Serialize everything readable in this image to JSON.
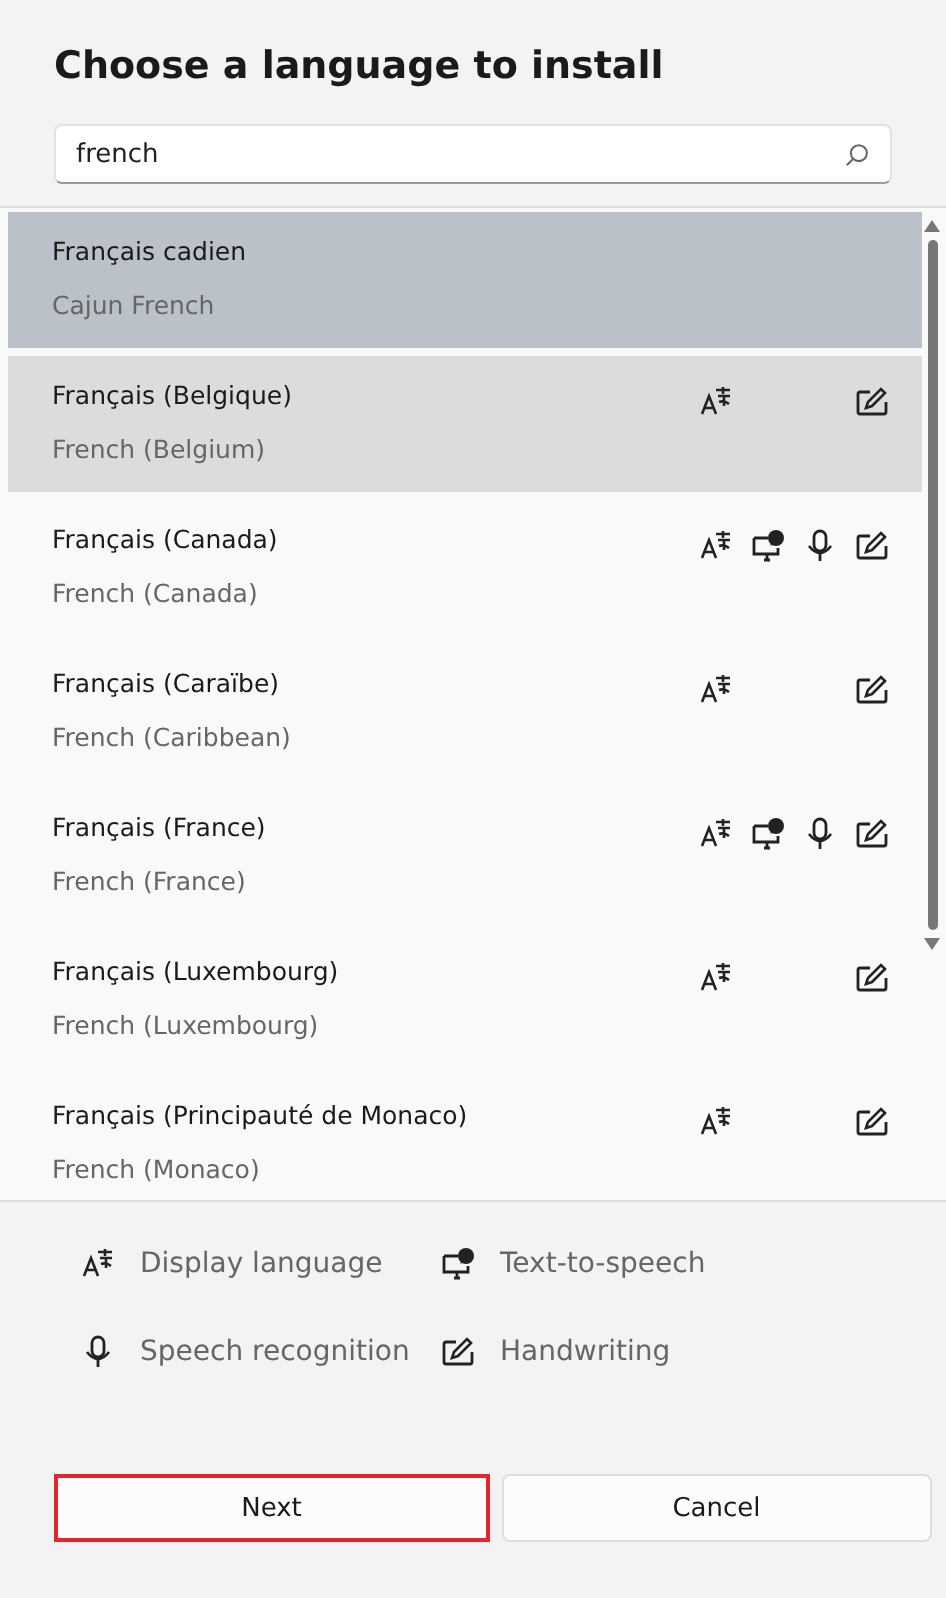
{
  "title": "Choose a language to install",
  "search": {
    "value": "french"
  },
  "languages": [
    {
      "name": "Français cadien",
      "english": "Cajun French",
      "selected": true,
      "hovered": false,
      "display": false,
      "tts": false,
      "speech": false,
      "handwriting": false
    },
    {
      "name": "Français (Belgique)",
      "english": "French (Belgium)",
      "selected": false,
      "hovered": true,
      "display": true,
      "tts": false,
      "speech": false,
      "handwriting": true
    },
    {
      "name": "Français (Canada)",
      "english": "French (Canada)",
      "selected": false,
      "hovered": false,
      "display": true,
      "tts": true,
      "speech": true,
      "handwriting": true
    },
    {
      "name": "Français (Caraïbe)",
      "english": "French (Caribbean)",
      "selected": false,
      "hovered": false,
      "display": true,
      "tts": false,
      "speech": false,
      "handwriting": true
    },
    {
      "name": "Français (France)",
      "english": "French (France)",
      "selected": false,
      "hovered": false,
      "display": true,
      "tts": true,
      "speech": true,
      "handwriting": true
    },
    {
      "name": "Français (Luxembourg)",
      "english": "French (Luxembourg)",
      "selected": false,
      "hovered": false,
      "display": true,
      "tts": false,
      "speech": false,
      "handwriting": true
    },
    {
      "name": "Français (Principauté de Monaco)",
      "english": "French (Monaco)",
      "selected": false,
      "hovered": false,
      "display": true,
      "tts": false,
      "speech": false,
      "handwriting": true
    }
  ],
  "legend": [
    {
      "kind": "display",
      "label": "Display language"
    },
    {
      "kind": "tts",
      "label": "Text-to-speech"
    },
    {
      "kind": "speech",
      "label": "Speech recognition"
    },
    {
      "kind": "handwriting",
      "label": "Handwriting"
    }
  ],
  "buttons": [
    {
      "label": "Next",
      "highlighted": true
    },
    {
      "label": "Cancel",
      "highlighted": false
    }
  ]
}
